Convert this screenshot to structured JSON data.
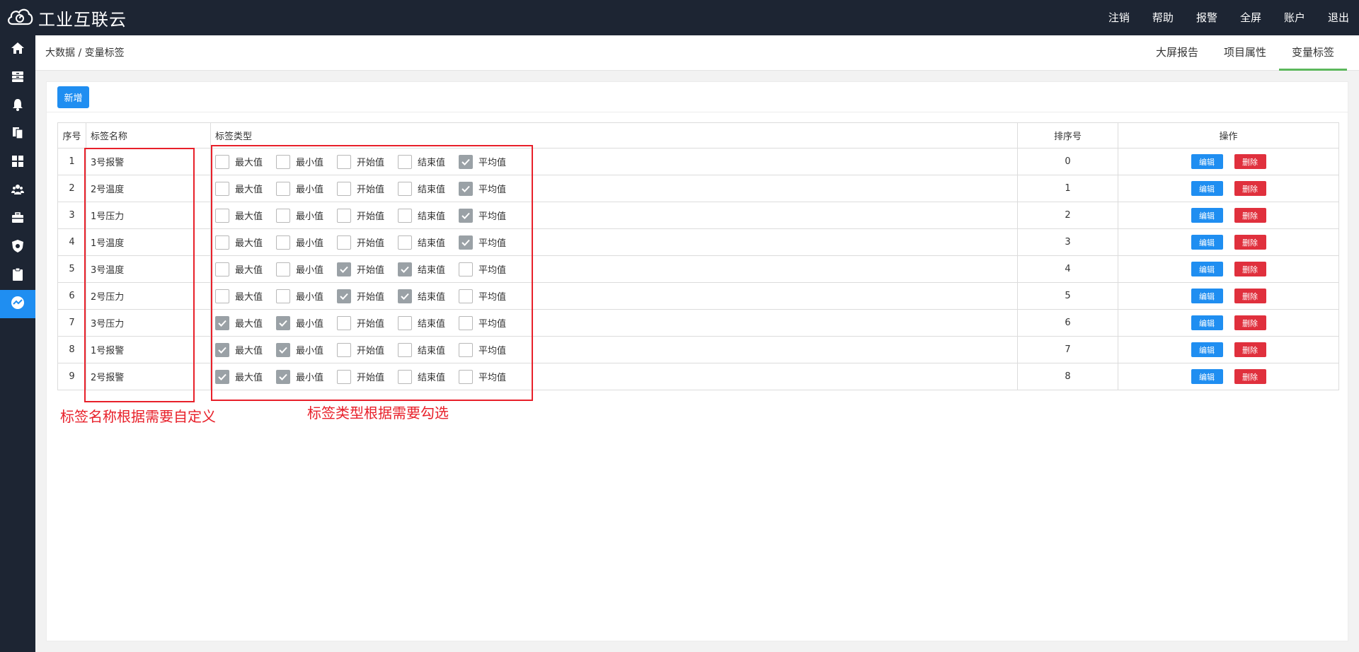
{
  "app": {
    "title": "工业互联云"
  },
  "topmenu": [
    "注销",
    "帮助",
    "报警",
    "全屏",
    "账户",
    "退出"
  ],
  "breadcrumb": "大数据 / 变量标签",
  "tabs": [
    {
      "label": "大屏报告",
      "active": false
    },
    {
      "label": "项目属性",
      "active": false
    },
    {
      "label": "变量标签",
      "active": true
    }
  ],
  "sidebar": {
    "items": [
      {
        "icon": "home-icon"
      },
      {
        "icon": "inbox-icon"
      },
      {
        "icon": "bell-icon"
      },
      {
        "icon": "copy-icon"
      },
      {
        "icon": "dashboard-icon"
      },
      {
        "icon": "user-group-icon"
      },
      {
        "icon": "briefcase-icon"
      },
      {
        "icon": "shield-icon"
      },
      {
        "icon": "clipboard-icon"
      },
      {
        "icon": "chart-line-icon",
        "active": true
      }
    ]
  },
  "toolbar": {
    "add_label": "新增"
  },
  "table": {
    "headers": [
      "序号",
      "标签名称",
      "标签类型",
      "排序号",
      "操作"
    ],
    "type_options": [
      "最大值",
      "最小值",
      "开始值",
      "结束值",
      "平均值"
    ],
    "edit_label": "编辑",
    "delete_label": "删除",
    "rows": [
      {
        "no": "1",
        "name": "3号报警",
        "checks": [
          false,
          false,
          false,
          false,
          true
        ],
        "sort": "0"
      },
      {
        "no": "2",
        "name": "2号温度",
        "checks": [
          false,
          false,
          false,
          false,
          true
        ],
        "sort": "1"
      },
      {
        "no": "3",
        "name": "1号压力",
        "checks": [
          false,
          false,
          false,
          false,
          true
        ],
        "sort": "2"
      },
      {
        "no": "4",
        "name": "1号温度",
        "checks": [
          false,
          false,
          false,
          false,
          true
        ],
        "sort": "3"
      },
      {
        "no": "5",
        "name": "3号温度",
        "checks": [
          false,
          false,
          true,
          true,
          false
        ],
        "sort": "4"
      },
      {
        "no": "6",
        "name": "2号压力",
        "checks": [
          false,
          false,
          true,
          true,
          false
        ],
        "sort": "5"
      },
      {
        "no": "7",
        "name": "3号压力",
        "checks": [
          true,
          true,
          false,
          false,
          false
        ],
        "sort": "6"
      },
      {
        "no": "8",
        "name": "1号报警",
        "checks": [
          true,
          true,
          false,
          false,
          false
        ],
        "sort": "7"
      },
      {
        "no": "9",
        "name": "2号报警",
        "checks": [
          true,
          true,
          false,
          false,
          false
        ],
        "sort": "8"
      }
    ]
  },
  "annotations": {
    "name_note": "标签名称根据需要自定义",
    "type_note": "标签类型根据需要勾选",
    "color": "#e8202a"
  },
  "colors": {
    "primary": "#1f8ef1",
    "danger": "#e0303d",
    "dark": "#1d2533",
    "tab_active": "#5cb85c"
  }
}
